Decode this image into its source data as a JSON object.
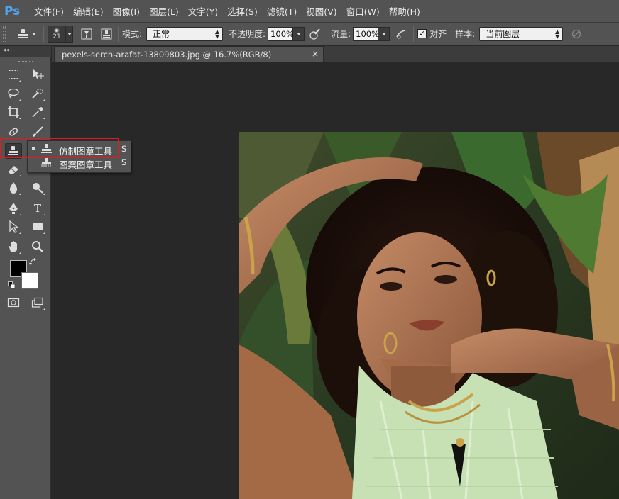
{
  "app": {
    "logo": "Ps"
  },
  "menubar": {
    "items": [
      "文件(F)",
      "编辑(E)",
      "图像(I)",
      "图层(L)",
      "文字(Y)",
      "选择(S)",
      "滤镜(T)",
      "视图(V)",
      "窗口(W)",
      "帮助(H)"
    ]
  },
  "options": {
    "brush_size": "21",
    "mode_label": "模式:",
    "mode_value": "正常",
    "opacity_label": "不透明度:",
    "opacity_value": "100%",
    "flow_label": "流量:",
    "flow_value": "100%",
    "aligned_label": "对齐",
    "aligned_checked": "✓",
    "sample_label": "样本:",
    "sample_value": "当前图层"
  },
  "document": {
    "tab_title": "pexels-serch-arafat-13809803.jpg @ 16.7%(RGB/8)",
    "close_glyph": "×"
  },
  "toolbox": {
    "collapse_glyph": "◂◂",
    "text_tool_glyph": "T"
  },
  "flyout": {
    "items": [
      {
        "label": "仿制图章工具",
        "shortcut": "S",
        "selected": true
      },
      {
        "label": "图案图章工具",
        "shortcut": "S",
        "selected": false
      }
    ]
  },
  "colors": {
    "foreground": "#000000",
    "background": "#ffffff",
    "highlight": "#e5191e"
  }
}
